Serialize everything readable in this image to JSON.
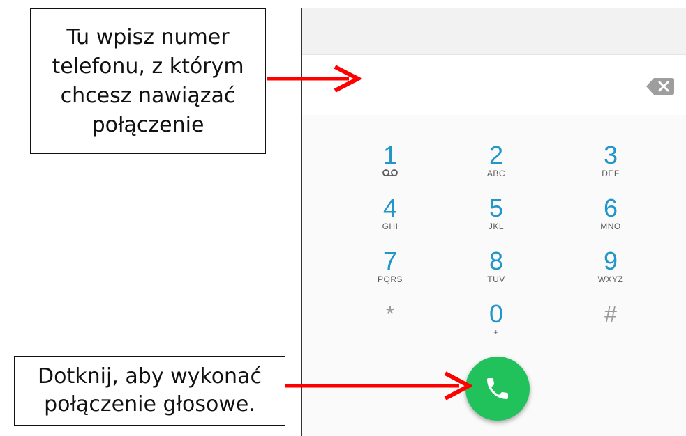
{
  "annotations": {
    "number_hint": [
      "Tu wpisz numer",
      "telefonu, z którym",
      "chcesz nawiązać",
      "połączenie"
    ],
    "call_hint": [
      "Dotknij, aby wykonać",
      "połączenie głosowe."
    ]
  },
  "dialer": {
    "number_value": "",
    "keys": [
      {
        "digit": "1",
        "letters": ""
      },
      {
        "digit": "2",
        "letters": "ABC"
      },
      {
        "digit": "3",
        "letters": "DEF"
      },
      {
        "digit": "4",
        "letters": "GHI"
      },
      {
        "digit": "5",
        "letters": "JKL"
      },
      {
        "digit": "6",
        "letters": "MNO"
      },
      {
        "digit": "7",
        "letters": "PQRS"
      },
      {
        "digit": "8",
        "letters": "TUV"
      },
      {
        "digit": "9",
        "letters": "WXYZ"
      },
      {
        "digit": "*",
        "letters": ""
      },
      {
        "digit": "0",
        "letters": "+"
      },
      {
        "digit": "#",
        "letters": ""
      }
    ]
  },
  "icons": {
    "backspace": "backspace-icon",
    "voicemail": "voicemail-icon",
    "call": "phone-icon"
  },
  "colors": {
    "digit": "#2196c8",
    "call_button": "#21c15b",
    "arrow": "#ff0000"
  }
}
